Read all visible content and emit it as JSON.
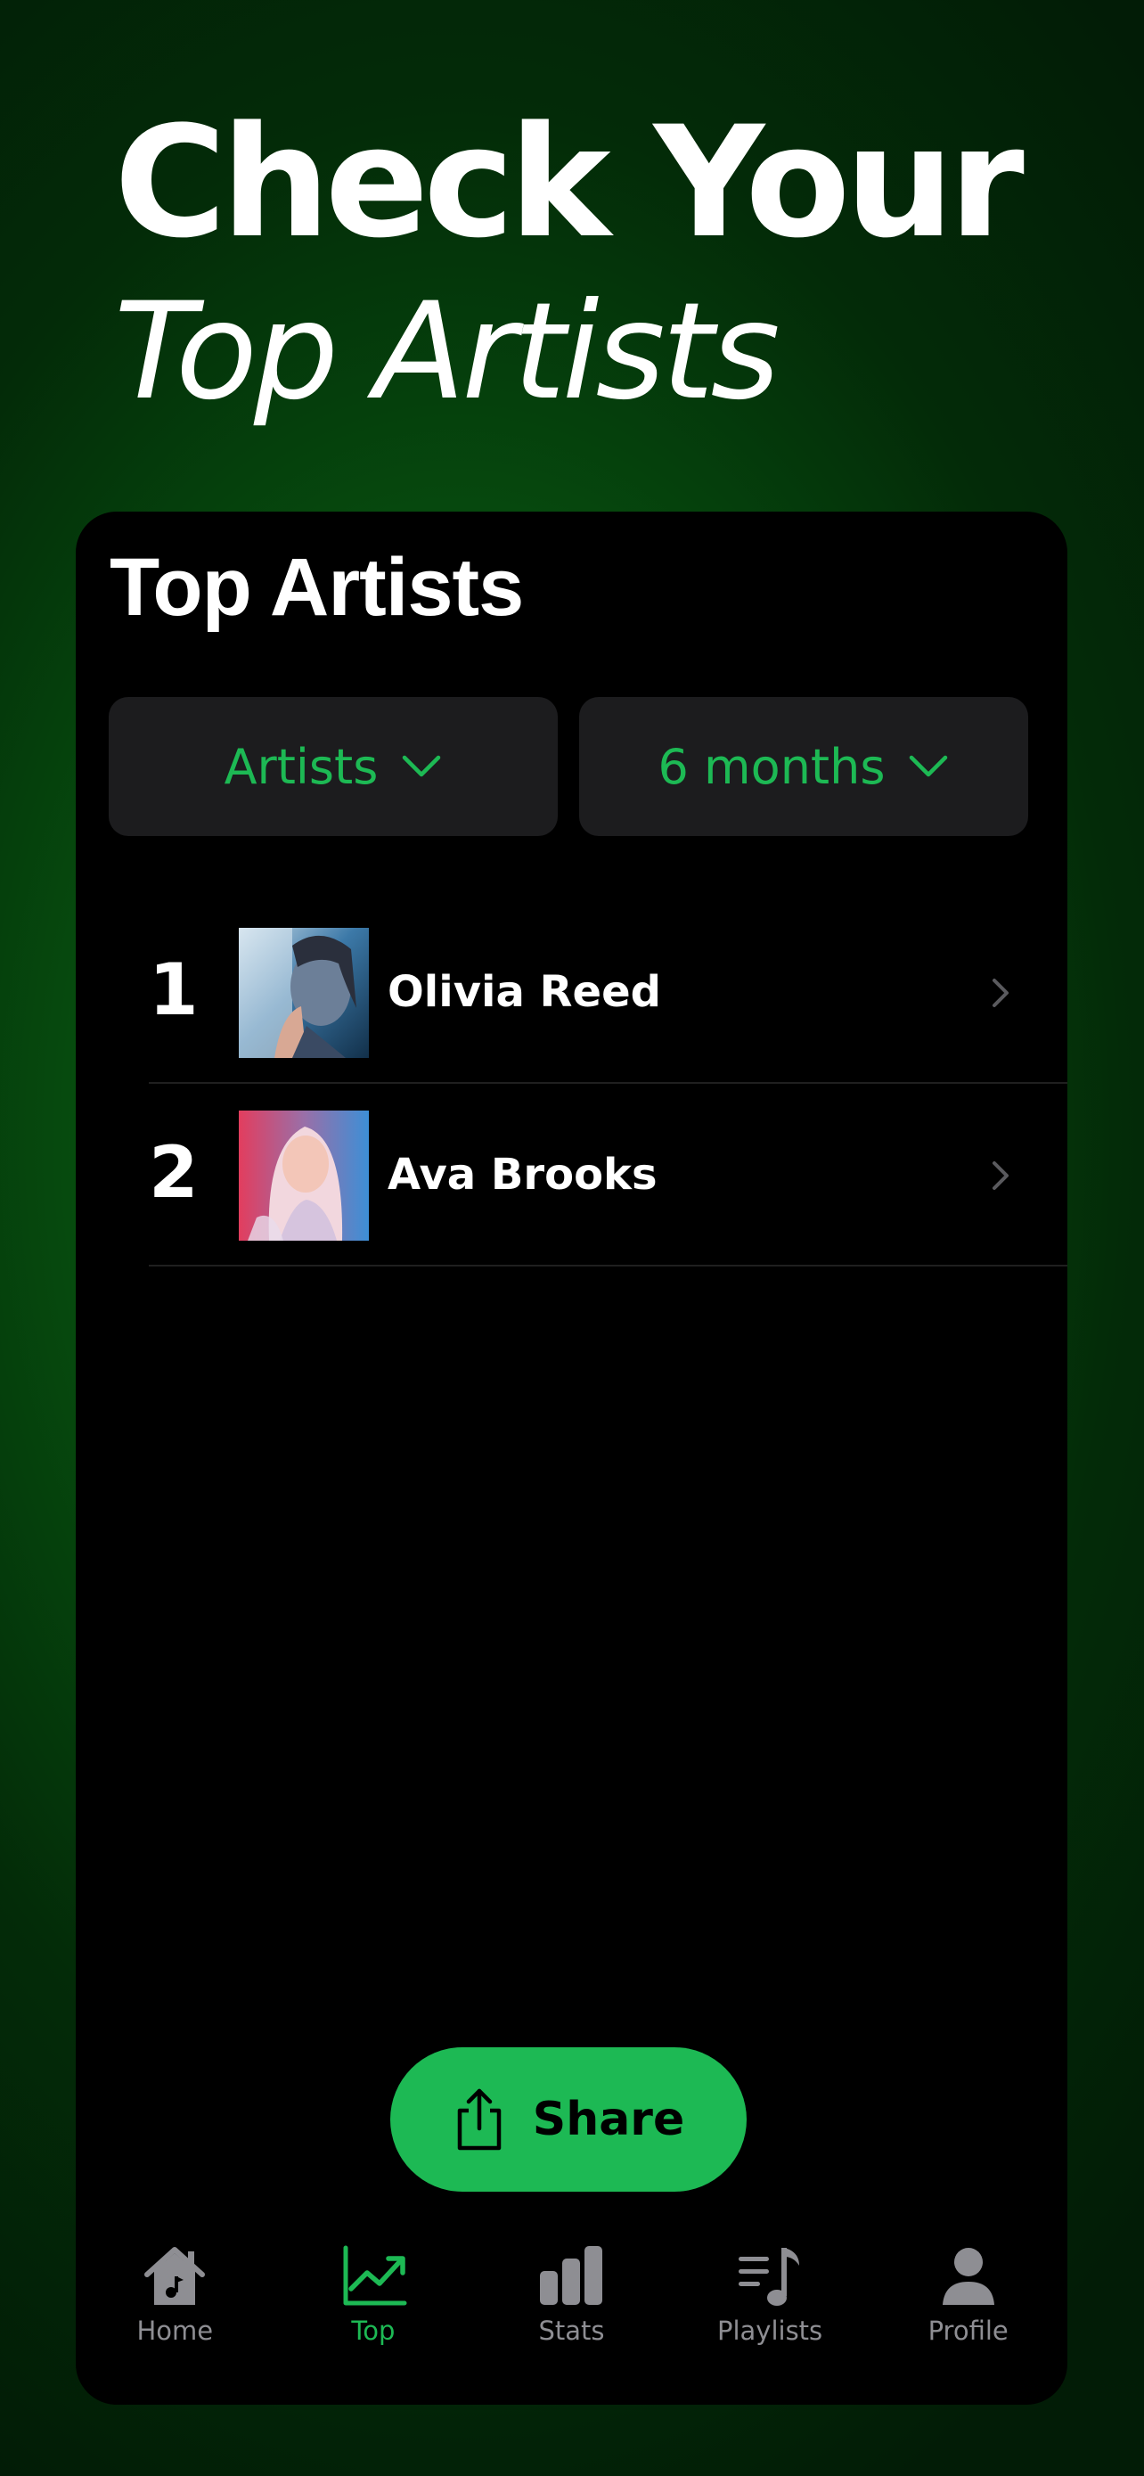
{
  "hero": {
    "line1": "Check Your",
    "line2": "Top Artists"
  },
  "card": {
    "title": "Top Artists",
    "filters": {
      "category": {
        "value": "Artists",
        "icon": "chevron-down-icon"
      },
      "range": {
        "value": "6 months",
        "icon": "chevron-down-icon"
      }
    },
    "artists": [
      {
        "rank": "1",
        "name": "Olivia Reed"
      },
      {
        "rank": "2",
        "name": "Ava Brooks"
      }
    ],
    "share_label": "Share"
  },
  "tabbar": {
    "items": [
      {
        "label": "Home",
        "icon": "home-icon",
        "active": false
      },
      {
        "label": "Top",
        "icon": "trending-icon",
        "active": true
      },
      {
        "label": "Stats",
        "icon": "bar-chart-icon",
        "active": false
      },
      {
        "label": "Playlists",
        "icon": "playlist-icon",
        "active": false
      },
      {
        "label": "Profile",
        "icon": "person-icon",
        "active": false
      }
    ]
  },
  "colors": {
    "accent": "#1db954",
    "card_bg": "#000000",
    "dropdown_bg": "#1c1c1e",
    "inactive": "#8e8e93"
  }
}
